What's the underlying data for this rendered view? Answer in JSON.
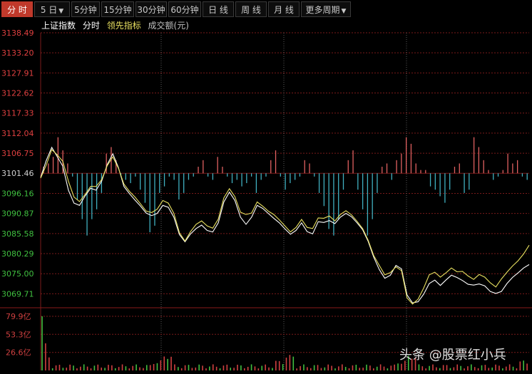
{
  "tabs": [
    {
      "label": "分 时",
      "active": true,
      "dropdown": false
    },
    {
      "label": "5 日",
      "active": false,
      "dropdown": true
    },
    {
      "label": "5分钟",
      "active": false,
      "dropdown": false
    },
    {
      "label": "15分钟",
      "active": false,
      "dropdown": false
    },
    {
      "label": "30分钟",
      "active": false,
      "dropdown": false
    },
    {
      "label": "60分钟",
      "active": false,
      "dropdown": false
    },
    {
      "label": "日 线",
      "active": false,
      "dropdown": false
    },
    {
      "label": "周 线",
      "active": false,
      "dropdown": false
    },
    {
      "label": "月 线",
      "active": false,
      "dropdown": false
    },
    {
      "label": "更多周期",
      "active": false,
      "dropdown": true
    }
  ],
  "legend": {
    "index_name": "上证指数",
    "intraday": "分时",
    "leading": "领先指标",
    "volume": "成交额(元)"
  },
  "colors": {
    "up": "#e06060",
    "down": "#40b0c0",
    "price_line": "#ffffff",
    "avg_line": "#e8e060",
    "axis_red": "#e04040",
    "axis_green": "#40c040",
    "grid": "#7a1a1a",
    "volume_bar": "#d04040",
    "volume_green": "#40c040"
  },
  "watermark": "头条 @股票红小兵",
  "chart_data": {
    "type": "line",
    "prev_close": 3101.46,
    "price_axis": {
      "ticks": [
        "3138.49",
        "3133.20",
        "3127.91",
        "3122.62",
        "3117.33",
        "3112.04",
        "3106.75",
        "3101.46",
        "3096.16",
        "3090.87",
        "3085.58",
        "3080.29",
        "3075.00",
        "3069.71"
      ],
      "ylim": [
        3066.4,
        3138.49
      ]
    },
    "volume_axis": {
      "ticks": [
        "79.9亿",
        "53.3亿",
        "26.6亿"
      ],
      "ylim": [
        0,
        79.9
      ]
    },
    "series": [
      {
        "values": [
          3100.4,
          3104.8,
          3108.3,
          3105.8,
          3103.3,
          3097.0,
          3093.6,
          3093.0,
          3095.5,
          3097.5,
          3097.0,
          3099.4,
          3103.8,
          3106.6,
          3103.0,
          3098.0,
          3096.1,
          3094.4,
          3092.8,
          3091.0,
          3090.3,
          3090.9,
          3093.0,
          3092.5,
          3089.9,
          3085.3,
          3083.4,
          3085.5,
          3086.9,
          3087.8,
          3086.4,
          3086.0,
          3088.4,
          3093.9,
          3096.5,
          3094.3,
          3089.9,
          3088.0,
          3089.9,
          3093.0,
          3092.2,
          3090.9,
          3089.6,
          3088.4,
          3086.8,
          3085.4,
          3086.4,
          3088.4,
          3086.1,
          3085.5,
          3088.7,
          3088.5,
          3089.0,
          3088.2,
          3089.9,
          3090.9,
          3090.0,
          3088.4,
          3086.6,
          3083.5,
          3079.4,
          3076.1,
          3073.8,
          3074.6,
          3077.2,
          3076.3,
          3069.4,
          3067.3,
          3067.6,
          3069.6,
          3072.4,
          3073.3,
          3071.9,
          3073.3,
          3074.6,
          3074.0,
          3073.2,
          3072.2,
          3072.0,
          3072.3,
          3071.8,
          3070.3,
          3069.8,
          3070.3,
          3072.4,
          3074.0,
          3075.2,
          3076.5,
          3077.4
        ]
      },
      {
        "values": [
          3100.2,
          3103.6,
          3107.7,
          3106.3,
          3104.6,
          3099.4,
          3095.2,
          3094.0,
          3095.9,
          3098.0,
          3098.0,
          3099.8,
          3103.5,
          3105.8,
          3102.8,
          3098.6,
          3096.7,
          3095.2,
          3093.4,
          3091.5,
          3091.1,
          3092.0,
          3094.3,
          3093.6,
          3090.9,
          3085.8,
          3083.6,
          3086.1,
          3088.0,
          3088.9,
          3087.6,
          3087.0,
          3089.4,
          3095.0,
          3097.4,
          3095.3,
          3091.2,
          3090.6,
          3091.0,
          3093.9,
          3092.8,
          3091.5,
          3090.6,
          3089.2,
          3087.6,
          3086.0,
          3087.2,
          3089.3,
          3087.2,
          3086.9,
          3089.7,
          3089.6,
          3090.2,
          3088.9,
          3090.6,
          3091.6,
          3090.5,
          3088.8,
          3086.9,
          3083.8,
          3079.8,
          3077.2,
          3074.7,
          3075.3,
          3076.8,
          3075.8,
          3068.6,
          3067.0,
          3068.3,
          3071.2,
          3074.7,
          3075.4,
          3074.1,
          3075.2,
          3076.5,
          3075.5,
          3075.6,
          3074.4,
          3073.5,
          3074.8,
          3074.1,
          3072.6,
          3071.5,
          3073.6,
          3075.4,
          3077.0,
          3078.4,
          3080.2,
          3082.5
        ]
      }
    ],
    "leading_bars": [
      2,
      3,
      5,
      11,
      7,
      3,
      -1,
      -8,
      -14,
      -19,
      -14,
      -11,
      -6,
      6,
      8,
      4,
      -1,
      -2,
      -3,
      -1,
      -5,
      -9,
      -18,
      -16,
      -6,
      -4,
      -1,
      -2,
      -8,
      -6,
      -2,
      -1,
      2,
      4,
      -1,
      -2,
      5,
      2,
      -1,
      -3,
      -2,
      -4,
      -3,
      -1,
      -6,
      -2,
      -1,
      4,
      7,
      -1,
      -5,
      -3,
      -2,
      -1,
      4,
      3,
      -1,
      -6,
      -10,
      -17,
      -19,
      -14,
      -5,
      4,
      7,
      -5,
      -11,
      -19,
      -14,
      -6,
      2,
      3,
      -2,
      4,
      6,
      11,
      9,
      3,
      1,
      1,
      -4,
      -5,
      -7,
      -9,
      -5,
      2,
      3,
      -6,
      -5,
      11,
      8,
      4,
      1,
      -2,
      -1,
      1,
      6,
      3,
      4,
      -1,
      -2
    ]
  }
}
